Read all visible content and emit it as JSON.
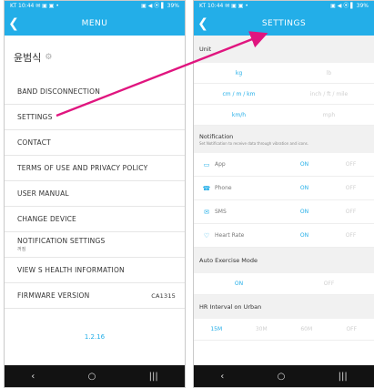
{
  "status_bar": {
    "left": "KT 10:44 ✉ ▣ ▣ •",
    "right": "▣ ◀ ⦿ ▌ 39%"
  },
  "left_screen": {
    "title": "MENU",
    "user_name": "윤범식",
    "menu": [
      {
        "label": "BAND DISCONNECTION"
      },
      {
        "label": "SETTINGS"
      },
      {
        "label": "CONTACT"
      },
      {
        "label": "TERMS OF USE AND PRIVACY POLICY"
      },
      {
        "label": "USER MANUAL"
      },
      {
        "label": "CHANGE DEVICE"
      },
      {
        "label": "NOTIFICATION SETTINGS",
        "sub": "꺼짐"
      },
      {
        "label": "VIEW S HEALTH INFORMATION"
      },
      {
        "label": "FIRMWARE VERSION",
        "value": "CA1315"
      }
    ],
    "app_version": "1.2.16"
  },
  "right_screen": {
    "title": "SETTINGS",
    "unit_header": "Unit",
    "unit_rows": [
      {
        "on": "kg",
        "off": "lb"
      },
      {
        "on": "cm / m / km",
        "off": "inch / ft / mile"
      },
      {
        "on": "km/h",
        "off": "mph"
      }
    ],
    "notification_header": "Notification",
    "notification_note": "Set Notification to receive data through vibration and icons.",
    "notifications": [
      {
        "label": "App",
        "icon": "app-icon",
        "on": "ON",
        "off": "OFF"
      },
      {
        "label": "Phone",
        "icon": "phone-icon",
        "on": "ON",
        "off": "OFF"
      },
      {
        "label": "SMS",
        "icon": "sms-icon",
        "on": "ON",
        "off": "OFF"
      },
      {
        "label": "Heart Rate",
        "icon": "heart-rate-icon",
        "on": "ON",
        "off": "OFF"
      }
    ],
    "auto_exercise_header": "Auto Exercise Mode",
    "auto_exercise": {
      "on": "ON",
      "off": "OFF"
    },
    "hr_interval_header": "HR Interval on Urban",
    "hr_interval_options": [
      "15M",
      "30M",
      "60M",
      "OFF"
    ],
    "hr_interval_selected": "15M"
  },
  "colors": {
    "accent": "#23aee8",
    "arrow": "#e0157f"
  }
}
